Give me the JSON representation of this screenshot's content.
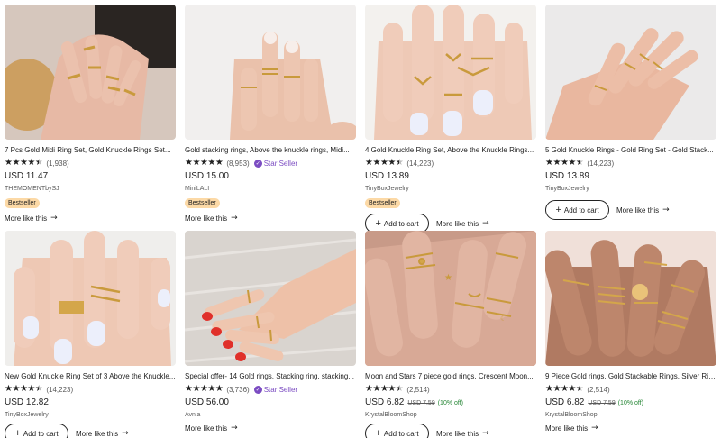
{
  "listings": [
    {
      "title": "7 Pcs Gold Midi Ring Set, Gold Knuckle Rings Set...",
      "reviews": "(1,938)",
      "price": "USD 11.47",
      "shop": "THEMOMENTbySJ",
      "badge": "Bestseller",
      "more": "More like this"
    },
    {
      "title": "Gold stacking rings, Above the knuckle rings, Midi...",
      "reviews": "(8,953)",
      "star_seller": "Star Seller",
      "price": "USD 15.00",
      "shop": "MiniLALI",
      "badge": "Bestseller",
      "more": "More like this"
    },
    {
      "title": "4 Gold Knuckle Ring Set, Above the Knuckle Rings...",
      "reviews": "(14,223)",
      "price": "USD 13.89",
      "shop": "TinyBoxJewelry",
      "badge": "Bestseller",
      "add_to_cart": "Add to cart",
      "more": "More like this"
    },
    {
      "title": "5 Gold Knuckle Rings - Gold Ring Set - Gold Stack...",
      "reviews": "(14,223)",
      "price": "USD 13.89",
      "shop": "TinyBoxJewelry",
      "add_to_cart": "Add to cart",
      "more": "More like this"
    },
    {
      "title": "New Gold Knuckle Ring Set of 3 Above the Knuckle...",
      "reviews": "(14,223)",
      "price": "USD 12.82",
      "shop": "TinyBoxJewelry",
      "add_to_cart": "Add to cart",
      "more": "More like this"
    },
    {
      "title": "Special offer- 14 Gold rings, Stacking ring, stacking...",
      "reviews": "(3,736)",
      "star_seller": "Star Seller",
      "price": "USD 56.00",
      "shop": "Avnia",
      "more": "More like this"
    },
    {
      "title": "Moon and Stars 7 piece gold rings, Crescent Moon...",
      "reviews": "(2,514)",
      "price": "USD 6.82",
      "original_price": "USD 7.59",
      "discount": "(10% off)",
      "shop": "KrystalBloomShop",
      "add_to_cart": "Add to cart",
      "more": "More like this"
    },
    {
      "title": "9 Piece Gold rings, Gold Stackable Rings, Silver Rin...",
      "reviews": "(2,514)",
      "price": "USD 6.82",
      "original_price": "USD 7.59",
      "discount": "(10% off)",
      "shop": "KrystalBloomShop",
      "more": "More like this"
    }
  ],
  "colors": {
    "star": "#222222",
    "badge_bg": "#fcd9a6",
    "star_seller": "#7b4cc2",
    "discount": "#258635"
  },
  "icons": {
    "star": "star-icon",
    "plus": "plus-icon",
    "arrow": "arrow-right-icon",
    "star_seller": "star-seller-icon"
  }
}
